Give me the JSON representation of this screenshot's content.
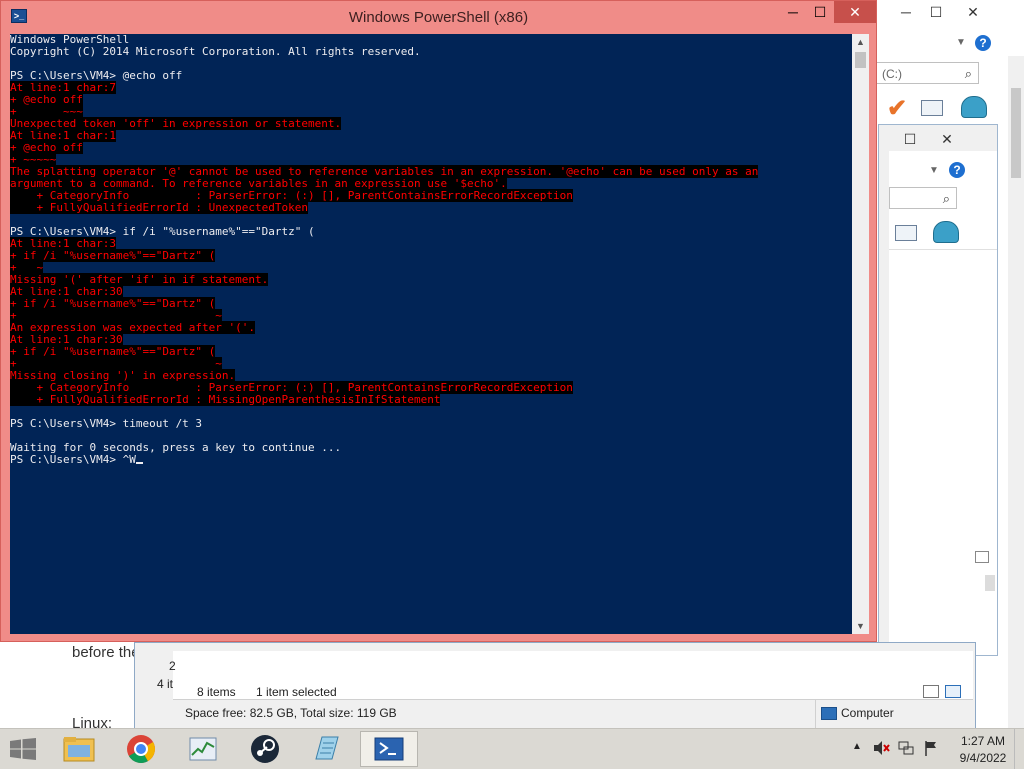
{
  "background_page": {
    "line1": "before the",
    "line2": "Linux:"
  },
  "explorer_back": {
    "search_placeholder": "(C:)"
  },
  "explorer_main": {
    "row_partial_text": "4 it",
    "item_count": "8 items",
    "selection": "1 item selected",
    "space_info": "Space free: 82.5 GB, Total size: 119 GB",
    "location": "Computer",
    "partial_digit": "2"
  },
  "powershell": {
    "title": "Windows PowerShell (x86)",
    "lines": [
      {
        "t": "Windows PowerShell",
        "e": false
      },
      {
        "t": "Copyright (C) 2014 Microsoft Corporation. All rights reserved.",
        "e": false
      },
      {
        "t": "",
        "e": false
      },
      {
        "t": "PS C:\\Users\\VM4> @echo off",
        "e": false
      },
      {
        "t": "At line:1 char:7",
        "e": true
      },
      {
        "t": "+ @echo off",
        "e": true
      },
      {
        "t": "+       ~~~",
        "e": true
      },
      {
        "t": "Unexpected token 'off' in expression or statement.",
        "e": true
      },
      {
        "t": "At line:1 char:1",
        "e": true
      },
      {
        "t": "+ @echo off",
        "e": true
      },
      {
        "t": "+ ~~~~~",
        "e": true
      },
      {
        "t": "The splatting operator '@' cannot be used to reference variables in an expression. '@echo' can be used only as an",
        "e": true
      },
      {
        "t": "argument to a command. To reference variables in an expression use '$echo'.",
        "e": true
      },
      {
        "t": "    + CategoryInfo          : ParserError: (:) [], ParentContainsErrorRecordException",
        "e": true
      },
      {
        "t": "    + FullyQualifiedErrorId : UnexpectedToken",
        "e": true
      },
      {
        "t": "",
        "e": false
      },
      {
        "t": "PS C:\\Users\\VM4> if /i \"%username%\"==\"Dartz\" (",
        "e": false
      },
      {
        "t": "At line:1 char:3",
        "e": true
      },
      {
        "t": "+ if /i \"%username%\"==\"Dartz\" (",
        "e": true
      },
      {
        "t": "+   ~",
        "e": true
      },
      {
        "t": "Missing '(' after 'if' in if statement.",
        "e": true
      },
      {
        "t": "At line:1 char:30",
        "e": true
      },
      {
        "t": "+ if /i \"%username%\"==\"Dartz\" (",
        "e": true
      },
      {
        "t": "+                              ~",
        "e": true
      },
      {
        "t": "An expression was expected after '('.",
        "e": true
      },
      {
        "t": "At line:1 char:30",
        "e": true
      },
      {
        "t": "+ if /i \"%username%\"==\"Dartz\" (",
        "e": true
      },
      {
        "t": "+                              ~",
        "e": true
      },
      {
        "t": "Missing closing ')' in expression.",
        "e": true
      },
      {
        "t": "    + CategoryInfo          : ParserError: (:) [], ParentContainsErrorRecordException",
        "e": true
      },
      {
        "t": "    + FullyQualifiedErrorId : MissingOpenParenthesisInIfStatement",
        "e": true
      },
      {
        "t": "",
        "e": false
      },
      {
        "t": "PS C:\\Users\\VM4> timeout /t 3",
        "e": false
      },
      {
        "t": "",
        "e": false
      },
      {
        "t": "Waiting for 0 seconds, press a key to continue ...",
        "e": false
      },
      {
        "t": "PS C:\\Users\\VM4> ^W",
        "e": false,
        "cursor": true
      }
    ]
  },
  "taskbar": {
    "apps": [
      "file-explorer",
      "chrome",
      "task-manager",
      "steam",
      "notepad",
      "powershell"
    ],
    "active_app": "powershell",
    "time": "1:27 AM",
    "date": "9/4/2022"
  },
  "colors": {
    "console_bg": "#012456",
    "console_fg": "#eeedf0",
    "error_fg": "#ff0000",
    "error_bg": "#000000",
    "window_frame": "#f08c88"
  }
}
